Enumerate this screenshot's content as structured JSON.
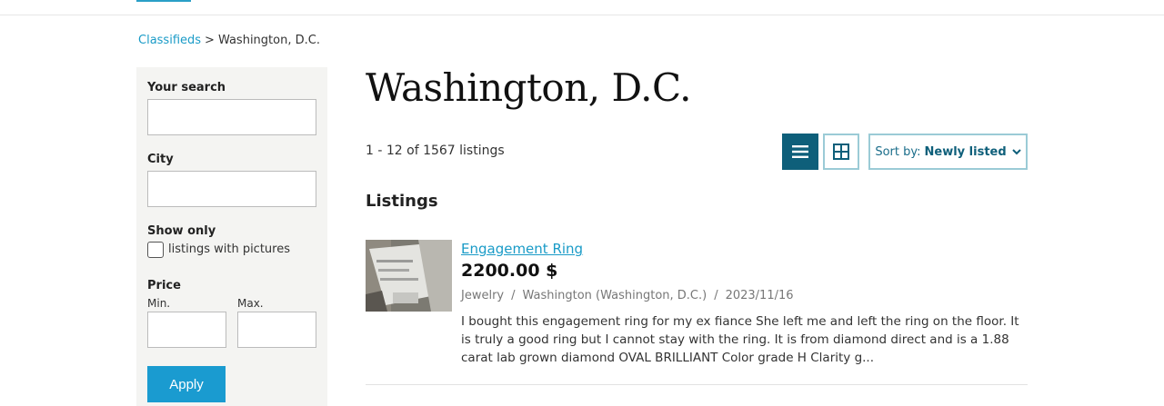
{
  "breadcrumb": {
    "root": "Classifieds",
    "separator": ">",
    "current": "Washington, D.C."
  },
  "filters": {
    "search_label": "Your search",
    "search_value": "",
    "city_label": "City",
    "city_value": "",
    "show_only_label": "Show only",
    "pictures_label": "listings with pictures",
    "pictures_checked": false,
    "price_label": "Price",
    "min_label": "Min.",
    "max_label": "Max.",
    "min_value": "",
    "max_value": "",
    "apply_label": "Apply"
  },
  "page": {
    "title": "Washington, D.C.",
    "listing_count": "1 - 12 of 1567 listings",
    "section_heading": "Listings"
  },
  "toolbar": {
    "list_view_icon": "list-icon",
    "grid_view_icon": "grid-icon",
    "sort_prefix": "Sort by:",
    "sort_value": "Newly listed",
    "active_view": "list"
  },
  "listings": [
    {
      "title": "Engagement Ring",
      "price": "2200.00 $",
      "category": "Jewelry",
      "location": "Washington (Washington, D.C.)",
      "date": "2023/11/16",
      "meta_separator": "/",
      "description": "I bought this engagement ring for my ex fiance She left me and left the ring on the floor. It is truly a good ring but I cannot stay with the ring. It is from diamond direct and is a 1.88 carat lab grown diamond OVAL BRILLIANT Color grade H Clarity g..."
    }
  ],
  "colors": {
    "accent": "#1a9bc7",
    "primary_dark": "#0e5f7a",
    "apply_button": "#1a9bd0",
    "sidebar_bg": "#f4f4f2"
  }
}
